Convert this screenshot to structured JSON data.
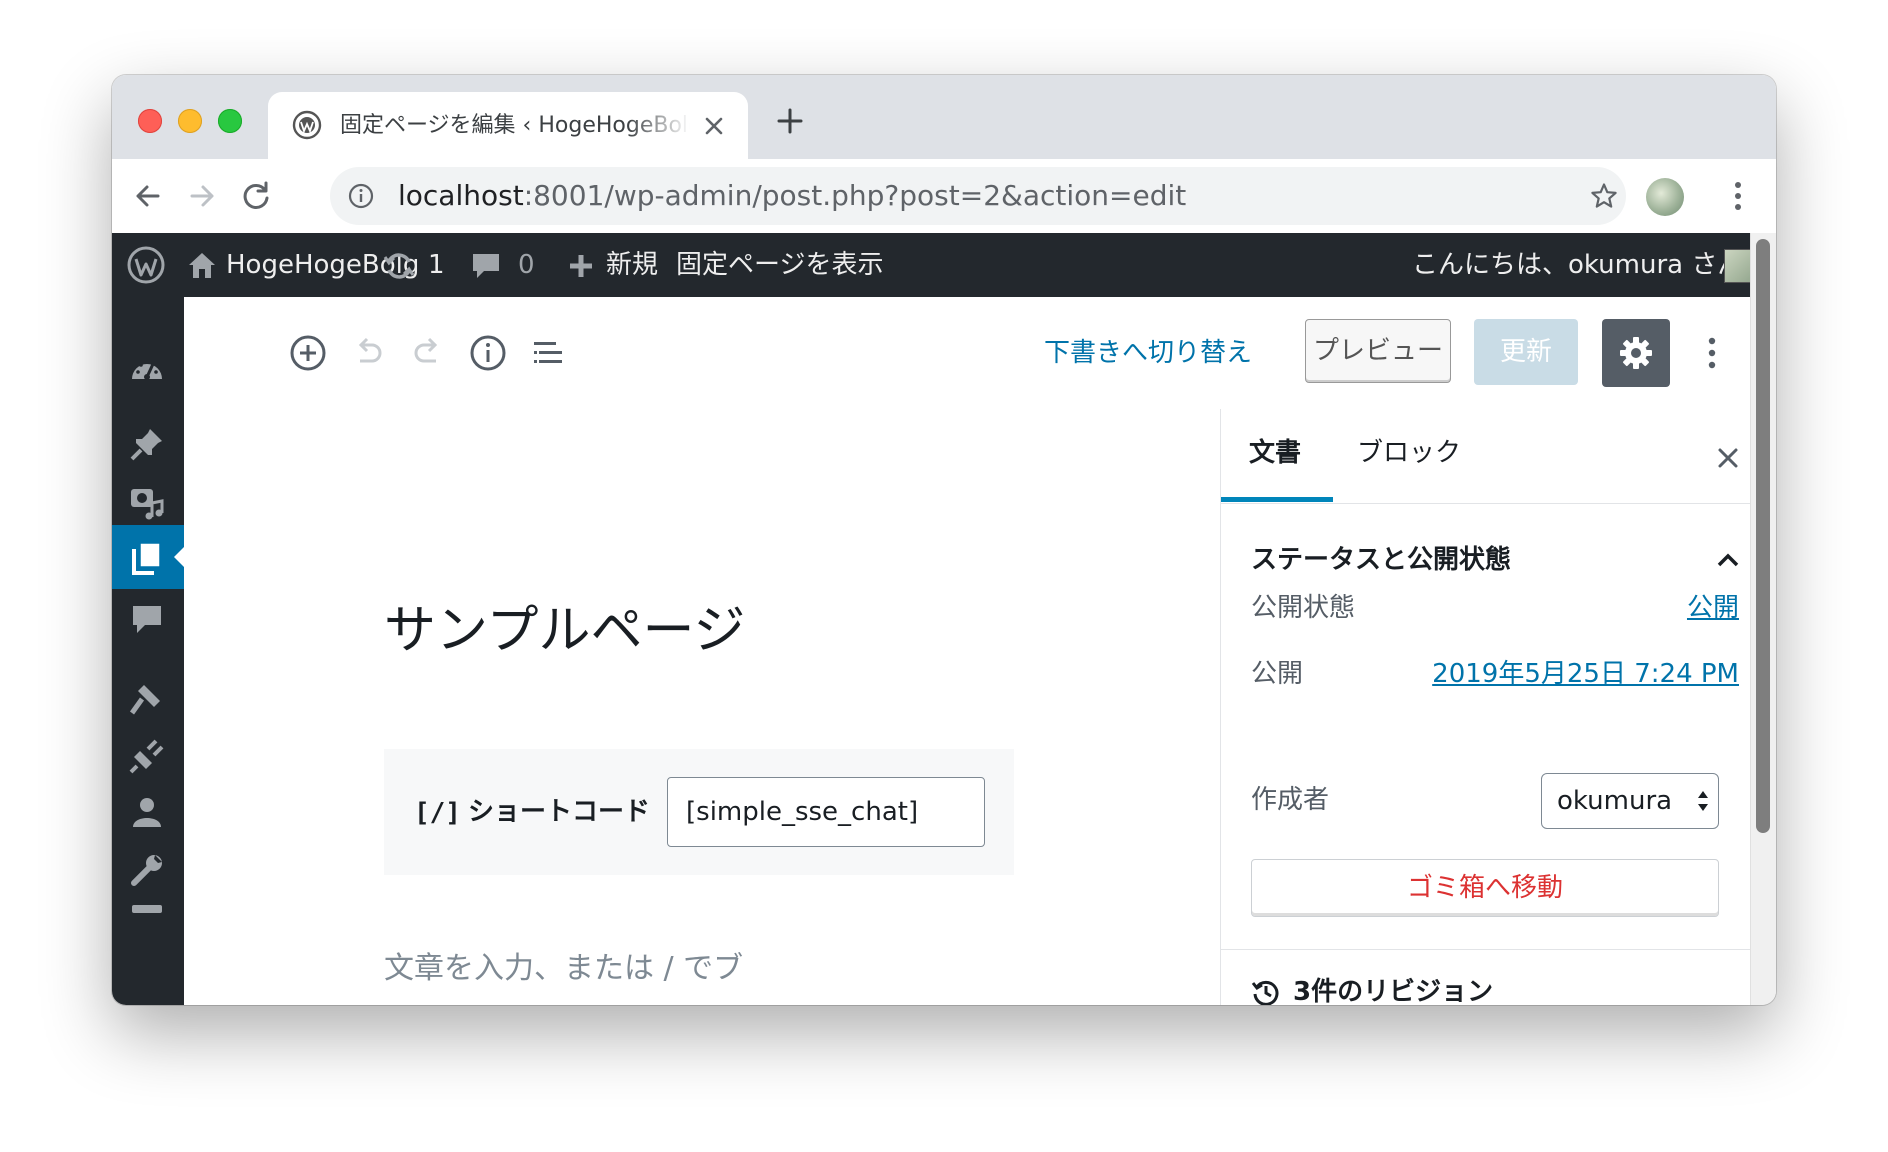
{
  "browser": {
    "tab_title": "固定ページを編集 ‹ HogeHogeBolg — WordPress",
    "url_host": "localhost",
    "url_rest": ":8001/wp-admin/post.php?post=2&action=edit"
  },
  "adminbar": {
    "site_name": "HogeHogeBolg",
    "updates_count": "1",
    "comments_count": "0",
    "new_label": "新規",
    "view_page_label": "固定ページを表示",
    "greeting": "こんにちは、okumura さん"
  },
  "editor": {
    "switch_to_draft_label": "下書きへ切り替え",
    "preview_label": "プレビュー",
    "update_label": "更新"
  },
  "content": {
    "post_title": "サンプルページ",
    "shortcode_icon": "[/]",
    "shortcode_label": "ショートコード",
    "shortcode_value": "[simple_sse_chat]",
    "paragraph_placeholder": "文章を入力、または / でブ"
  },
  "settings_sidebar": {
    "tab_document": "文書",
    "tab_block": "ブロック",
    "section_title": "ステータスと公開状態",
    "visibility_label": "公開状態",
    "visibility_value": "公開",
    "publish_label": "公開",
    "publish_value": "2019年5月25日 7:24 PM",
    "author_label": "作成者",
    "author_value": "okumura",
    "trash_label": "ゴミ箱へ移動",
    "revisions_label": "3件のリビジョン"
  },
  "colors": {
    "admin_bar_bg": "#23282d",
    "accent_blue": "#0073aa",
    "destructive_red": "#dc3232",
    "update_disabled": "#c9dce6"
  },
  "icons": [
    "wordpress-logo-icon",
    "home-icon",
    "updates-icon",
    "comment-icon",
    "plus-icon",
    "dashboard-icon",
    "pin-icon",
    "media-icon",
    "pages-icon",
    "comments-icon",
    "appearance-icon",
    "plugins-icon",
    "users-icon",
    "tools-icon",
    "add-block-icon",
    "undo-icon",
    "redo-icon",
    "info-icon",
    "outline-icon",
    "gear-icon",
    "more-vertical-icon",
    "close-icon",
    "chevron-up-icon",
    "history-icon"
  ]
}
